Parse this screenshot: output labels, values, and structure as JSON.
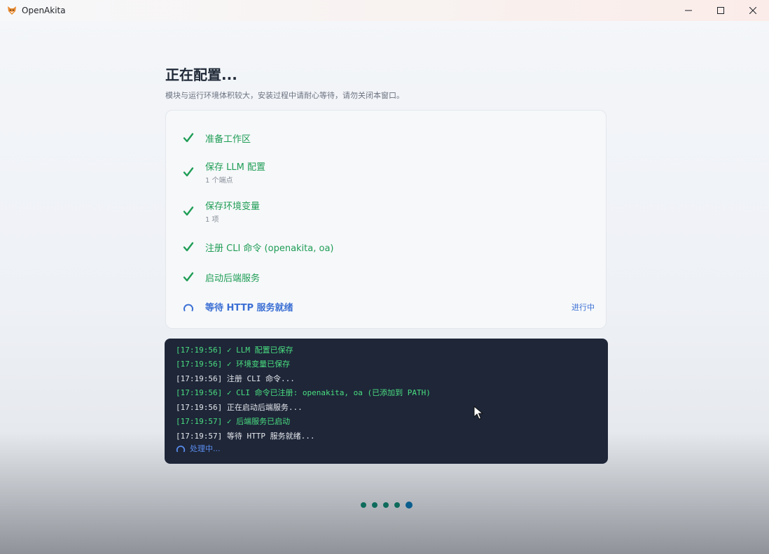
{
  "window": {
    "title": "OpenAkita"
  },
  "page": {
    "title": "正在配置...",
    "subtitle": "模块与运行环境体积较大，安装过程中请耐心等待，请勿关闭本窗口。"
  },
  "steps": [
    {
      "label": "准备工作区",
      "sub": "",
      "state": "done"
    },
    {
      "label": "保存 LLM 配置",
      "sub": "1 个端点",
      "state": "done"
    },
    {
      "label": "保存环境变量",
      "sub": "1 项",
      "state": "done"
    },
    {
      "label": "注册 CLI 命令 (openakita, oa)",
      "sub": "",
      "state": "done"
    },
    {
      "label": "启动后端服务",
      "sub": "",
      "state": "done"
    },
    {
      "label": "等待 HTTP 服务就绪",
      "sub": "",
      "state": "active",
      "status": "进行中"
    }
  ],
  "log": {
    "lines": [
      {
        "text": "[17:19:56] ✓ LLM 配置已保存",
        "kind": "ok"
      },
      {
        "text": "[17:19:56] ✓ 环境变量已保存",
        "kind": "ok"
      },
      {
        "text": "[17:19:56] 注册 CLI 命令...",
        "kind": "info"
      },
      {
        "text": "[17:19:56] ✓ CLI 命令已注册: openakita, oa (已添加到 PATH)",
        "kind": "ok"
      },
      {
        "text": "[17:19:56] 正在启动后端服务...",
        "kind": "info"
      },
      {
        "text": "[17:19:57] ✓ 后端服务已启动",
        "kind": "ok"
      },
      {
        "text": "[17:19:57] 等待 HTTP 服务就绪...",
        "kind": "info"
      }
    ],
    "processing": "处理中..."
  },
  "pager": {
    "total": 5,
    "current": 5
  },
  "colors": {
    "done": "#1f9d55",
    "active": "#3b6fd4",
    "log_bg": "#1e2638",
    "log_ok": "#4ade80"
  },
  "icons": {
    "app": "fox-icon",
    "done": "check-icon",
    "active": "spinner-icon"
  }
}
